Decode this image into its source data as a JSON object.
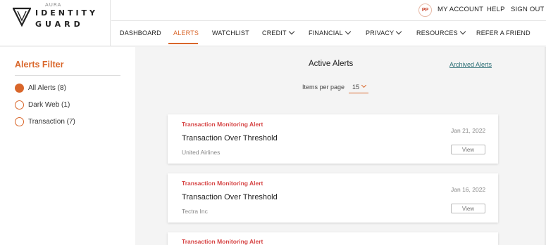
{
  "brand": {
    "aura": "AURA",
    "line1": "IDENTITY",
    "line2": "GUARD"
  },
  "user": {
    "initials": "PP",
    "my_account": "MY ACCOUNT",
    "help": "HELP",
    "sign_out": "SIGN OUT"
  },
  "nav": {
    "items": [
      {
        "label": "DASHBOARD"
      },
      {
        "label": "ALERTS"
      },
      {
        "label": "WATCHLIST"
      },
      {
        "label": "CREDIT"
      },
      {
        "label": "FINANCIAL"
      },
      {
        "label": "PRIVACY"
      },
      {
        "label": "RESOURCES"
      },
      {
        "label": "REFER A FRIEND"
      }
    ],
    "active": "ALERTS"
  },
  "filter": {
    "title": "Alerts Filter",
    "options": [
      {
        "label": "All Alerts (8)",
        "checked": true
      },
      {
        "label": "Dark Web (1)",
        "checked": false
      },
      {
        "label": "Transaction (7)",
        "checked": false
      }
    ]
  },
  "main": {
    "title": "Active Alerts",
    "archived_link": "Archived Alerts",
    "items_per_page_label": "Items per page",
    "items_per_page_value": "15"
  },
  "alerts": [
    {
      "type": "Transaction Monitoring Alert",
      "title": "Transaction Over Threshold",
      "merchant": "United Airlines",
      "date": "Jan 21, 2022",
      "view_label": "View"
    },
    {
      "type": "Transaction Monitoring Alert",
      "title": "Transaction Over Threshold",
      "merchant": "Tectra Inc",
      "date": "Jan 16, 2022",
      "view_label": "View"
    },
    {
      "type": "Transaction Monitoring Alert"
    }
  ],
  "colors": {
    "accent": "#d9662a",
    "alert_red": "#d64545",
    "link_teal": "#2b6e75"
  }
}
